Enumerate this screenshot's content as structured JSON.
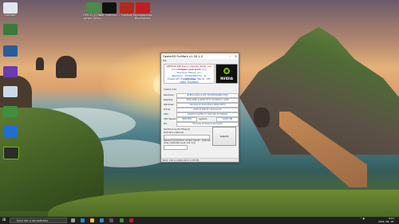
{
  "desktop": {
    "icons": [
      {
        "label": "Lomtárr"
      },
      {
        "label": ""
      },
      {
        "label": ""
      },
      {
        "label": ""
      },
      {
        "label": ""
      },
      {
        "label": ""
      },
      {
        "label": "Microsoft Edge"
      },
      {
        "label": ""
      }
    ],
    "top_icons": [
      {
        "label": "GPU-Z (1) Ro... power-Shop..."
      },
      {
        "label": "KMI Sndterm..."
      },
      {
        "label": "FurMark"
      },
      {
        "label": "Equegra­phion Benchmark"
      }
    ]
  },
  "window": {
    "title": "Geeks3D FurMark v1.30.1.0",
    "menu": "File",
    "banner": {
      "line1": "GEEKS3D GPU Burner (OpenGL, 64-bit, run)",
      "line2": "<<< Compare your score >>>",
      "line3": "Stay Only! Hangry, 4 (r)",
      "line4": "Resolution : 1920x1080 (FS) - 4x Loseamples",
      "line5": "Enable GFX (5.1 GT0, driver 546.33 - OFF 00001 75%/8000)"
    },
    "custom_label": "Custom 3.54",
    "fields": [
      {
        "label": "Renderer",
        "value": "NVIDIA GeForce GTX 1070/PCIe/SSE2 (MSI)"
      },
      {
        "label": "Desktop",
        "value": "1920x1080 @ 60Hz (37.6, 50-0009-0 x 1600"
      },
      {
        "label": "Windows",
        "value": "Windows 10 64-bit Build 19045 (RTM)"
      },
      {
        "label": "Driver",
        "value": "GeForce 546.33 / OpenGL 4.6"
      },
      {
        "label": "CPU",
        "value": "Intel(R) Core(TM) i7-7700 CPU @ 3.60GHz"
      }
    ],
    "cpu_speed": {
      "label": "CPU Speed",
      "value": "3600 MHz",
      "sys_label": "System Memory",
      "sys_value": "16327 MB"
    },
    "os": {
      "label": "OS",
      "value": "Windows 10 64-bit build 19045"
    },
    "submit_section": {
      "heading": "Submit score (for Phoenix)",
      "nick_label": "Nickname (optional)",
      "nick_value": "",
      "pass_label": "Password (protection private submit - optional)",
      "pass_value": "",
      "hint": "(Only characters [a-z], A-Z, 0-9)",
      "submit_button": "Submit"
    },
    "status": "Build: 1.30.1.0 (2022-04-21 11:55:48)"
  },
  "taskbar": {
    "search_placeholder": "Írjon ide a kereséshez",
    "time": "8:57",
    "date": "2024. 08. 18."
  }
}
